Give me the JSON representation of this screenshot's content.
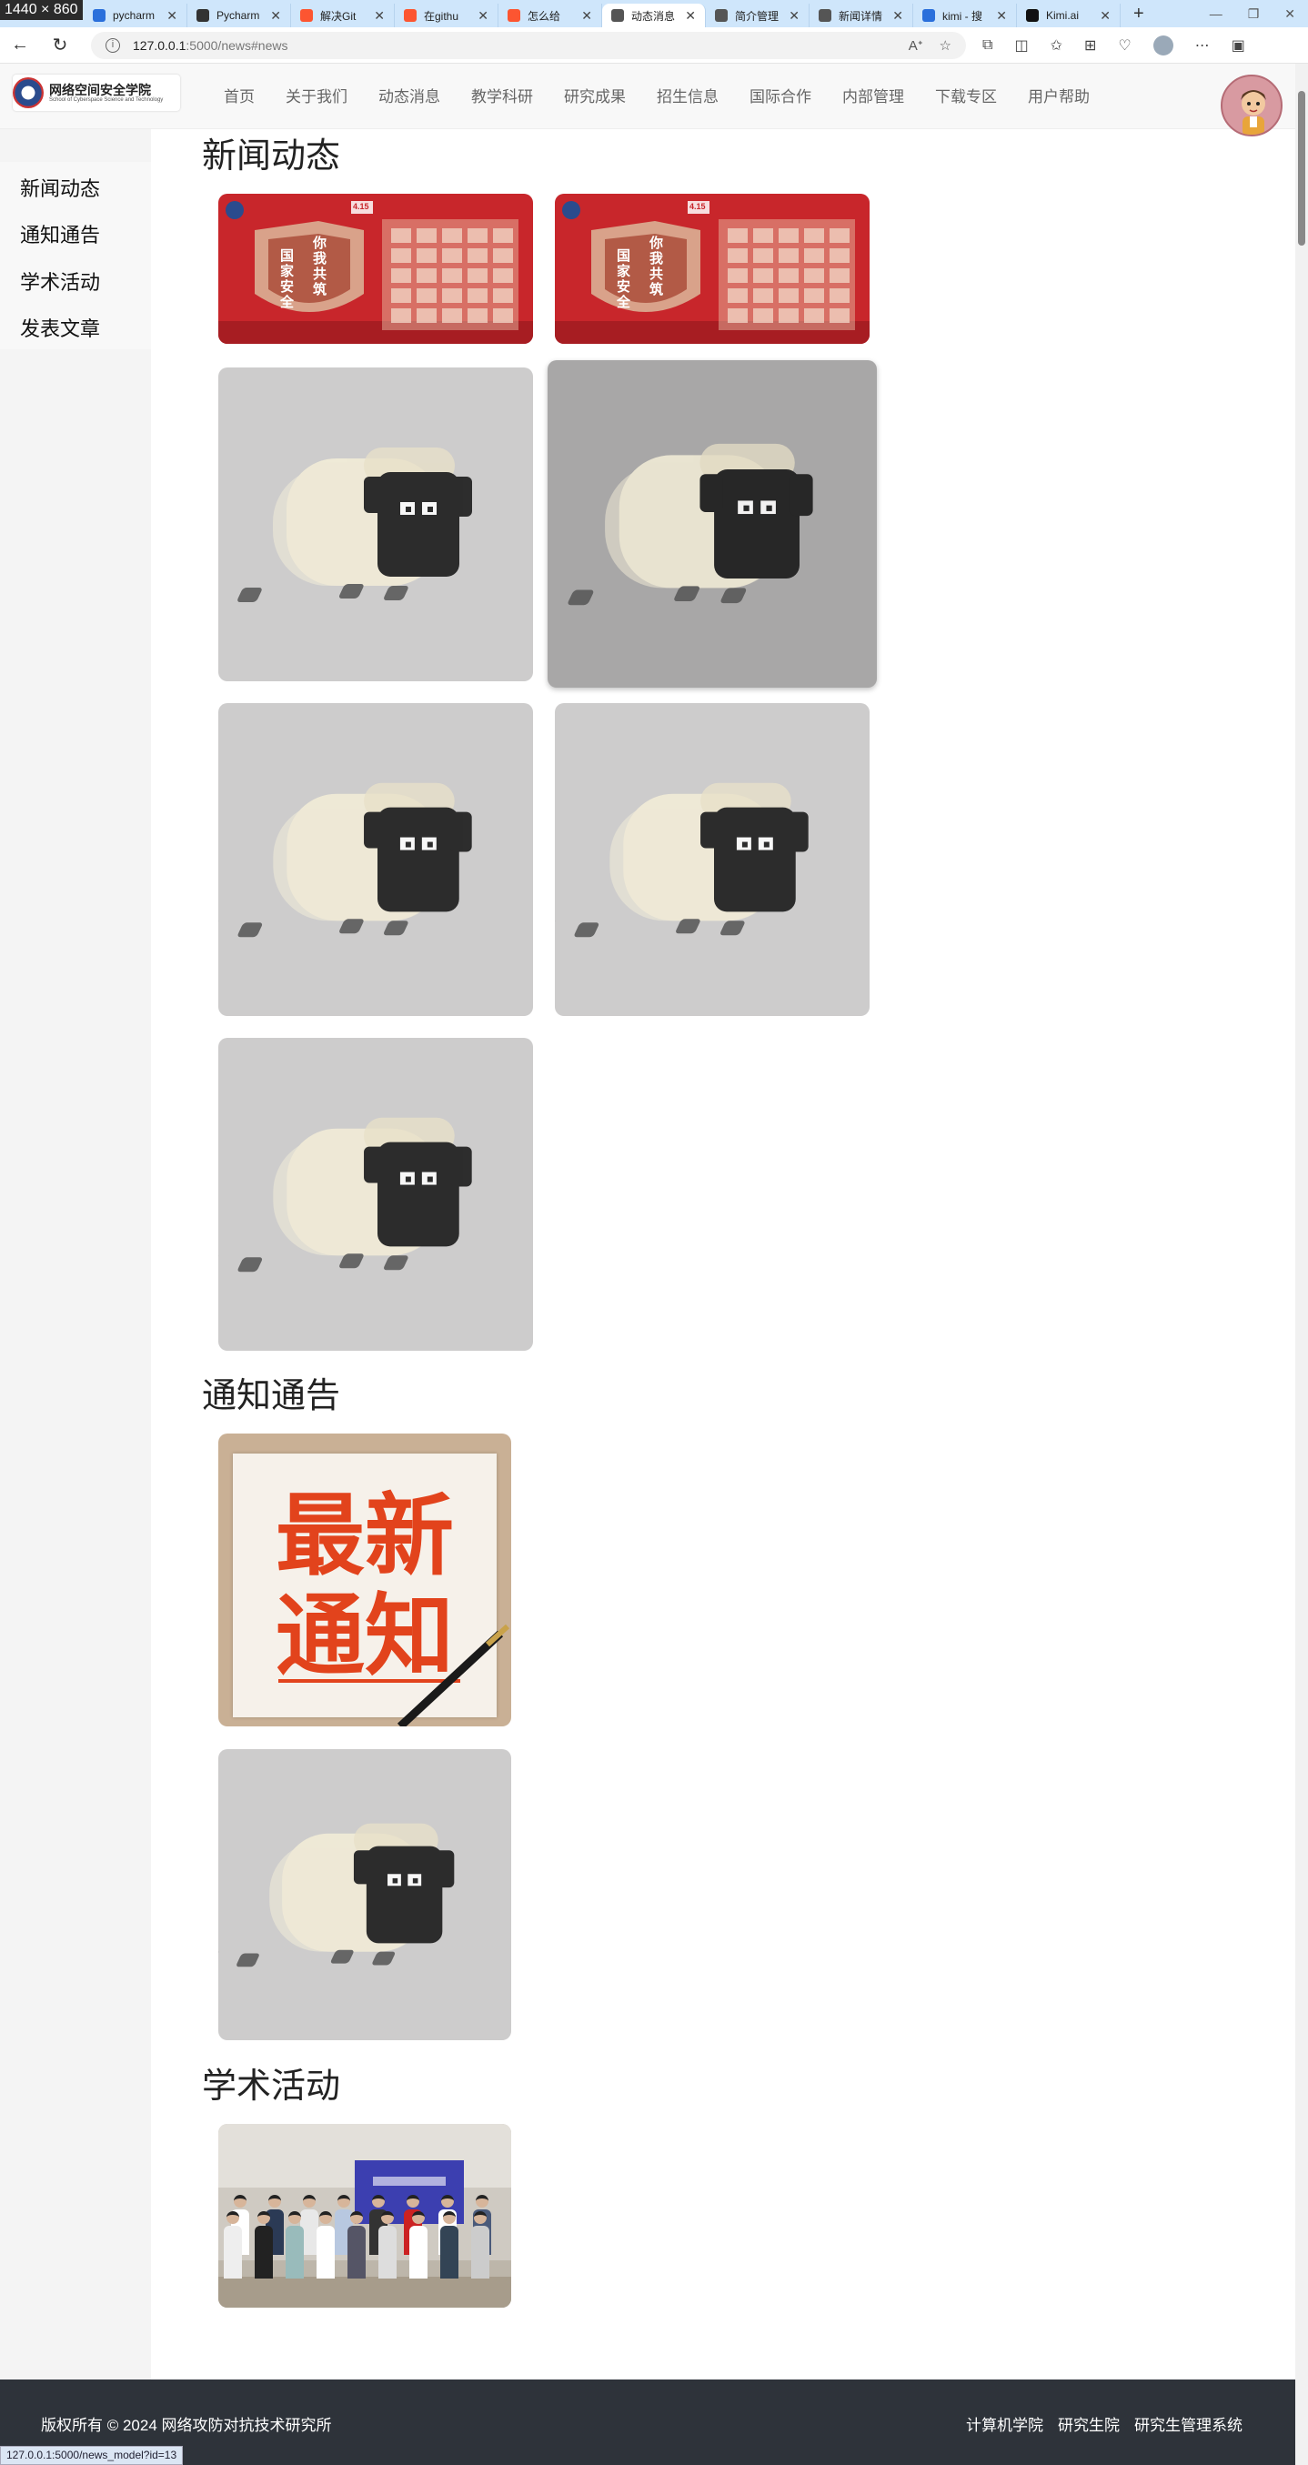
{
  "screenshot_badge": "1440 × 860",
  "browser": {
    "tabs": [
      {
        "title": "pycharm",
        "icon": "search-icon",
        "color": "#2a6fdb"
      },
      {
        "title": "Pycharm",
        "icon": "github-icon",
        "color": "#333333"
      },
      {
        "title": "解决Git",
        "icon": "csdn-icon",
        "color": "#fc5531"
      },
      {
        "title": "在githu",
        "icon": "csdn-icon",
        "color": "#fc5531"
      },
      {
        "title": "怎么给",
        "icon": "csdn-icon",
        "color": "#fc5531"
      },
      {
        "title": "动态消息",
        "icon": "page-icon",
        "color": "#555555"
      },
      {
        "title": "简介管理",
        "icon": "page-icon",
        "color": "#555555"
      },
      {
        "title": "新闻详情",
        "icon": "page-icon",
        "color": "#555555"
      },
      {
        "title": "kimi - 搜",
        "icon": "search-icon",
        "color": "#2a6fdb"
      },
      {
        "title": "Kimi.ai",
        "icon": "kimi-icon",
        "color": "#111111"
      }
    ],
    "active_tab_index": 5,
    "url_host": "127.0.0.1",
    "url_path": ":5000/news#news",
    "status_url": "127.0.0.1:5000/news_model?id=13"
  },
  "site": {
    "logo_text": "网络空间安全学院",
    "logo_subtext": "School of Cyberspace Science and Technology",
    "nav": [
      "首页",
      "关于我们",
      "动态消息",
      "教学科研",
      "研究成果",
      "招生信息",
      "国际合作",
      "内部管理",
      "下载专区",
      "用户帮助"
    ]
  },
  "sidebar": {
    "items": [
      "新闻动态",
      "通知通告",
      "学术活动",
      "发表文章"
    ]
  },
  "sections": {
    "news": {
      "title": "新闻动态",
      "cards": [
        {
          "image": "security-banner",
          "hover": false
        },
        {
          "image": "security-banner",
          "hover": false
        },
        {
          "image": "sheep-placeholder",
          "hover": false
        },
        {
          "image": "sheep-placeholder",
          "hover": true
        },
        {
          "image": "sheep-placeholder",
          "hover": false
        },
        {
          "image": "sheep-placeholder",
          "hover": false
        },
        {
          "image": "sheep-placeholder",
          "hover": false
        }
      ]
    },
    "notices": {
      "title": "通知通告",
      "poster_line1": "最新",
      "poster_line2": "通知",
      "cards": [
        {
          "image": "notice-poster"
        },
        {
          "image": "sheep-placeholder"
        }
      ]
    },
    "academic": {
      "title": "学术活动",
      "cards": [
        {
          "image": "group-photo"
        }
      ]
    }
  },
  "banner_text": {
    "left_vertical": "国家安全",
    "right_vertical": "你我共筑",
    "badge": "4.15"
  },
  "footer": {
    "copyright": "版权所有 © 2024 网络攻防对抗技术研究所",
    "links": [
      "计算机学院",
      "研究生院",
      "研究生管理系统"
    ]
  },
  "colors": {
    "tab_bar": "#cfe6fb",
    "card_placeholder": "#cdcccc",
    "footer": "#2e333a",
    "banner_red": "#c8262b",
    "poster_red": "#e2431c"
  }
}
